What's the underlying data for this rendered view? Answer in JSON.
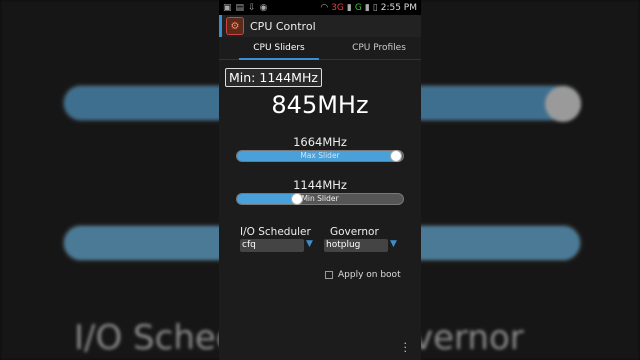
{
  "background": {
    "left_text": "I/O Schedu",
    "right_text": "vernor"
  },
  "status_bar": {
    "left_icons": [
      "sim-icon",
      "image-icon",
      "download-icon",
      "messenger-icon"
    ],
    "network_label": "3G",
    "network_label_2": "G",
    "time": "2:55 PM"
  },
  "app": {
    "title": "CPU Control"
  },
  "tabs": [
    {
      "label": "CPU Sliders",
      "selected": true
    },
    {
      "label": "CPU Profiles",
      "selected": false
    }
  ],
  "min_tooltip": "Min: 1144MHz",
  "current_frequency": "845MHz",
  "max_slider": {
    "value_label": "1664MHz",
    "track_label": "Max Slider",
    "level": 0.99
  },
  "min_slider": {
    "value_label": "1144MHz",
    "track_label": "Min Slider",
    "level": 0.35
  },
  "io_scheduler": {
    "label": "I/O Scheduler",
    "value": "cfq"
  },
  "governor": {
    "label": "Governor",
    "value": "hotplug"
  },
  "apply_on_boot": {
    "label": "Apply on boot",
    "checked": false
  },
  "colors": {
    "accent": "#3a8fd0",
    "slider_fill": "#4aa0d8"
  }
}
